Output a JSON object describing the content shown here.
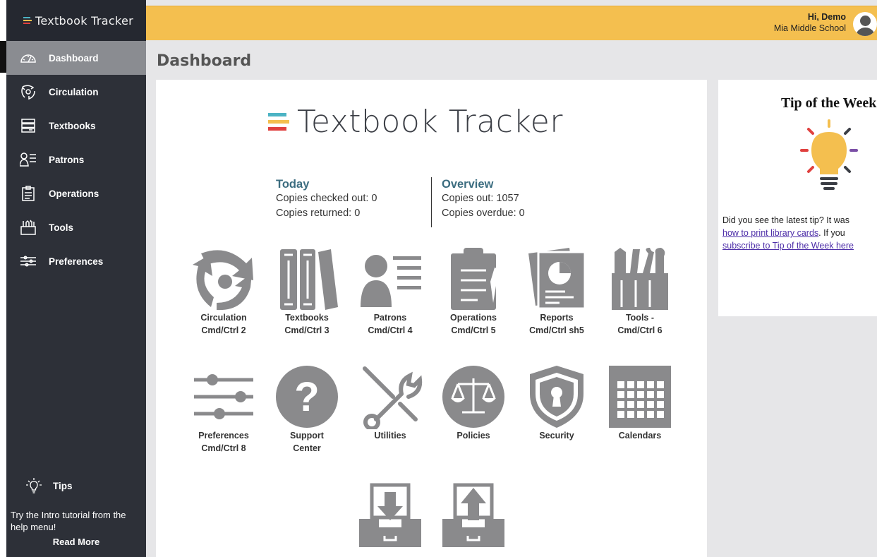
{
  "app": {
    "brand": "Textbook Tracker",
    "logo_colors": [
      "#4cb3c4",
      "#f4bf4f",
      "#e0413f"
    ]
  },
  "sidebar": {
    "items": [
      {
        "label": "Dashboard",
        "icon": "gauge-icon",
        "active": true
      },
      {
        "label": "Circulation",
        "icon": "circulation-icon"
      },
      {
        "label": "Textbooks",
        "icon": "books-icon"
      },
      {
        "label": "Patrons",
        "icon": "patrons-icon"
      },
      {
        "label": "Operations",
        "icon": "clipboard-icon"
      },
      {
        "label": "Tools",
        "icon": "tools-icon"
      },
      {
        "label": "Preferences",
        "icon": "sliders-icon"
      }
    ],
    "tips": {
      "label": "Tips",
      "text": "Try the Intro tutorial from the help menu!",
      "read_more": "Read More"
    }
  },
  "header": {
    "greeting": "Hi, Demo",
    "school": "Mia Middle School",
    "bg_color": "#f4bf4f"
  },
  "page": {
    "title": "Dashboard"
  },
  "stats": {
    "today": {
      "title": "Today",
      "checked_out": "Copies checked out: 0",
      "returned": "Copies returned: 0"
    },
    "overview": {
      "title": "Overview",
      "copies_out": "Copies out: 1057",
      "overdue": "Copies overdue: 0"
    }
  },
  "tiles": {
    "circulation": {
      "line1": "Circulation",
      "line2": "Cmd/Ctrl 2"
    },
    "textbooks": {
      "line1": "Textbooks",
      "line2": "Cmd/Ctrl 3"
    },
    "patrons": {
      "line1": "Patrons",
      "line2": "Cmd/Ctrl 4"
    },
    "operations": {
      "line1": "Operations",
      "line2": "Cmd/Ctrl 5"
    },
    "reports": {
      "line1": "Reports",
      "line2": "Cmd/Ctrl sh5"
    },
    "tools": {
      "line1": "Tools -",
      "line2": "Cmd/Ctrl 6"
    },
    "preferences": {
      "line1": "Preferences",
      "line2": "Cmd/Ctrl 8"
    },
    "support": {
      "line1": "Support",
      "line2": "Center"
    },
    "utilities": {
      "line1": "Utilities"
    },
    "policies": {
      "line1": "Policies"
    },
    "security": {
      "line1": "Security"
    },
    "calendars": {
      "line1": "Calendars"
    },
    "import": {
      "icon": "inbox-download-icon"
    },
    "export": {
      "icon": "inbox-upload-icon"
    }
  },
  "tip_panel": {
    "title": "Tip of the Week",
    "line1": "Did you see the latest tip? It was",
    "link1": "how to print library cards",
    "line2_rest": ". If you",
    "link2": "subscribe to Tip of the Week here"
  },
  "colors": {
    "sidebar": "#2d3038",
    "active_item": "#8a8c91",
    "icon_gray": "#8a8a8c",
    "stat_title": "#3c6d80"
  }
}
